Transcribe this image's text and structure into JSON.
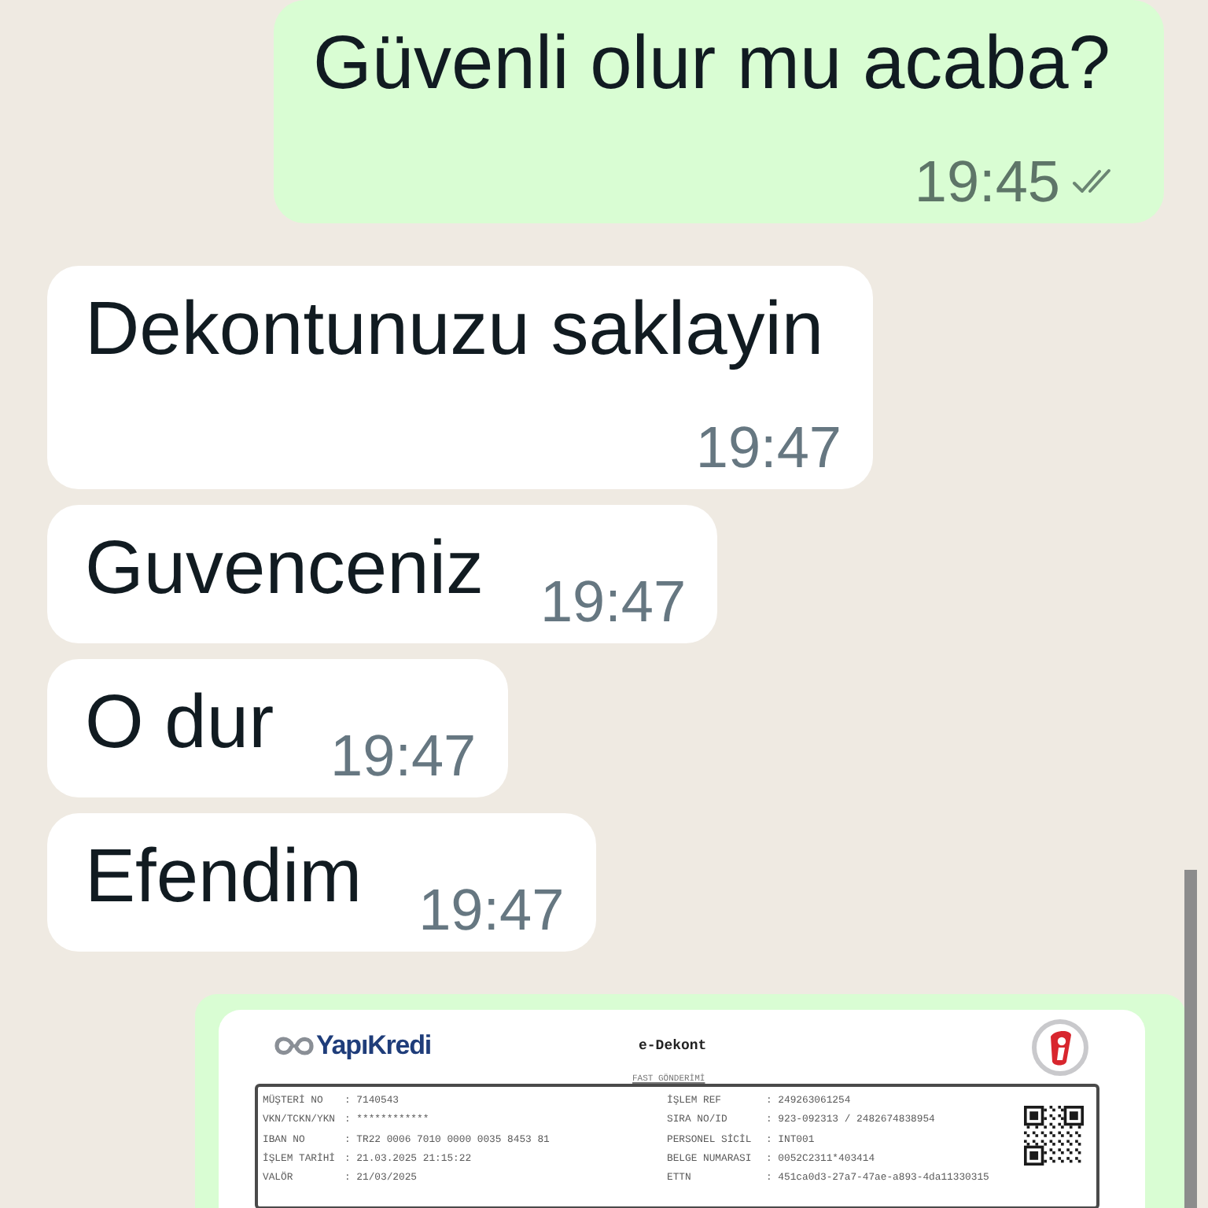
{
  "messages": [
    {
      "kind": "text",
      "outgoing": true,
      "text": "Güvenli olur mu acaba?",
      "time": "19:45",
      "read": false
    },
    {
      "kind": "text",
      "outgoing": false,
      "text": "Dekontunuzu saklayin",
      "time": "19:47"
    },
    {
      "kind": "text",
      "outgoing": false,
      "text": "Guvenceniz",
      "time": "19:47"
    },
    {
      "kind": "text",
      "outgoing": false,
      "text": "O dur",
      "time": "19:47"
    },
    {
      "kind": "text",
      "outgoing": false,
      "text": "Efendim",
      "time": "19:47"
    },
    {
      "kind": "image",
      "outgoing": true,
      "document": {
        "bank": "YapıKredi",
        "title": "e-Dekont",
        "subtitle": "FAST GÖNDERİMİ",
        "left_fields": [
          {
            "label": "MÜŞTERİ NO",
            "value": ": 7140543"
          },
          {
            "label": "VKN/TCKN/YKN",
            "value": ": ************"
          },
          {
            "label": "IBAN NO",
            "value": ": TR22 0006 7010 0000 0035 8453 81"
          },
          {
            "label": "İŞLEM TARİHİ",
            "value": ": 21.03.2025 21:15:22"
          },
          {
            "label": "VALÖR",
            "value": ": 21/03/2025"
          }
        ],
        "right_fields": [
          {
            "label": "İŞLEM REF",
            "value": ": 249263061254"
          },
          {
            "label": "SIRA NO/ID",
            "value": ": 923-092313 / 2482674838954"
          },
          {
            "label": "PERSONEL SİCİL",
            "value": ": INT001"
          },
          {
            "label": "BELGE NUMARASI",
            "value": ": 0052C2311*403414"
          },
          {
            "label": "ETTN",
            "value": ": 451ca0d3-27a7-47ae-a893-4da11330315"
          }
        ]
      }
    }
  ]
}
